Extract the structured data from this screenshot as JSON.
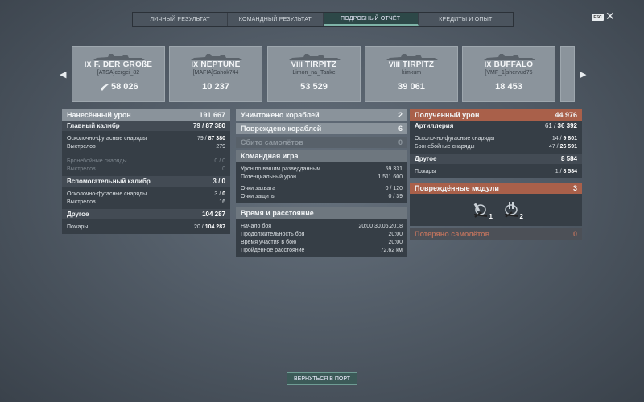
{
  "tabs": [
    "ЛИЧНЫЙ РЕЗУЛЬТАТ",
    "КОМАНДНЫЙ РЕЗУЛЬТАТ",
    "ПОДРОБНЫЙ ОТЧЁТ",
    "КРЕДИТЫ И ОПЫТ"
  ],
  "active_tab": "ПОДРОБНЫЙ ОТЧЁТ",
  "esc_label": "ESC",
  "close_icon": "close-icon",
  "ships": [
    {
      "tier": "IX",
      "name": "F. DER GROßE",
      "player": "[ATSA]cergei_82",
      "score": "58 026",
      "medal": "medal-icon"
    },
    {
      "tier": "IX",
      "name": "NEPTUNE",
      "player": "[MAFIA]Sahok744",
      "score": "10 237"
    },
    {
      "tier": "VIII",
      "name": "TIRPITZ",
      "player": "Limon_na_Tanke",
      "score": "53 529"
    },
    {
      "tier": "VIII",
      "name": "TIRPITZ",
      "player": "kimkum",
      "score": "39 061"
    },
    {
      "tier": "IX",
      "name": "BUFFALO",
      "player": "[VMF_1]shervud76",
      "score": "18 453"
    }
  ],
  "left": {
    "dealt": {
      "label": "Нанесённый урон",
      "value": "191 667"
    },
    "main": {
      "label": "Главный калибр",
      "value": "79",
      "total": "87 380",
      "rows": [
        {
          "label": "Осколочно-фугасные снаряды",
          "value": "79",
          "total": "87 380"
        },
        {
          "label": "Выстрелов",
          "value": "279"
        }
      ],
      "ap_rows": [
        {
          "label": "Бронебойные снаряды",
          "value": "0 / 0"
        },
        {
          "label": "Выстрелов",
          "value": "0"
        }
      ]
    },
    "secondary": {
      "label": "Вспомогательный калибр",
      "value": "3",
      "total": "0",
      "rows": [
        {
          "label": "Осколочно-фугасные снаряды",
          "value": "3",
          "total": "0"
        },
        {
          "label": "Выстрелов",
          "value": "16"
        }
      ]
    },
    "other": {
      "label": "Другое",
      "value": "104 287",
      "rows": [
        {
          "label": "Пожары",
          "value": "20",
          "total": "104 287"
        }
      ]
    }
  },
  "middle": {
    "destroyed": {
      "label": "Уничтожено кораблей",
      "value": "2"
    },
    "damaged": {
      "label": "Повреждено кораблей",
      "value": "6"
    },
    "planes": {
      "label": "Сбито самолётов",
      "value": "0"
    },
    "team": {
      "label": "Командная игра",
      "rows": [
        {
          "label": "Урон по вашим разведданным",
          "value": "59 331"
        },
        {
          "label": "Потенциальный урон",
          "value": "1 511 600"
        },
        {
          "label": "Очки захвата",
          "value": "0 / 120"
        },
        {
          "label": "Очки защиты",
          "value": "0 / 39"
        }
      ]
    },
    "time": {
      "label": "Время и расстояние",
      "rows": [
        {
          "label": "Начало боя",
          "value": "20:00  30.06.2018"
        },
        {
          "label": "Продолжительность боя",
          "value": "20:00"
        },
        {
          "label": "Время участия в бою",
          "value": "20:00"
        },
        {
          "label": "Пройденное расстояние",
          "value": "72.62 км"
        }
      ]
    }
  },
  "right": {
    "received": {
      "label": "Полученный урон",
      "value": "44 976"
    },
    "artillery": {
      "label": "Артиллерия",
      "value": "61",
      "total": "36 392",
      "rows": [
        {
          "label": "Осколочно-фугасные снаряды",
          "value": "14",
          "total": "9 801"
        },
        {
          "label": "Бронебойные снаряды",
          "value": "47",
          "total": "26 591"
        }
      ]
    },
    "other": {
      "label": "Другое",
      "value": "8 584",
      "rows": [
        {
          "label": "Пожары",
          "value": "1",
          "total": "8 584"
        }
      ]
    },
    "modules": {
      "label": "Повреждённые модули",
      "value": "3",
      "items": [
        {
          "icon": "torpedo-tube-icon",
          "count": "1"
        },
        {
          "icon": "gun-turret-icon",
          "count": "2"
        }
      ]
    },
    "planes_lost": {
      "label": "Потеряно самолётов",
      "value": "0"
    }
  },
  "return_button": "ВЕРНУТЬСЯ В ПОРТ"
}
